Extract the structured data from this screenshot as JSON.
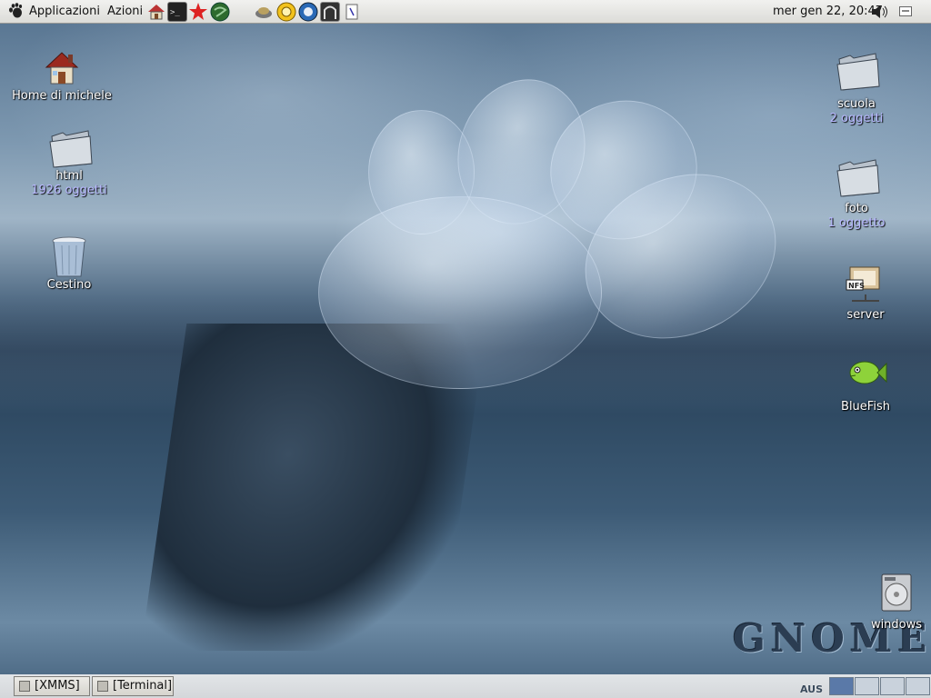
{
  "top_panel": {
    "menus": [
      "Applicazioni",
      "Azioni"
    ],
    "launchers": [
      "home-launcher",
      "terminal-launcher",
      "star-launcher",
      "web-launcher",
      "gimp-launcher",
      "sun-launcher",
      "browser-launcher",
      "ethereal-launcher",
      "note-launcher"
    ],
    "clock": "mer gen 22, 20:47"
  },
  "desktop": {
    "left_icons": [
      {
        "name": "Home di michele",
        "icon": "home-icon"
      },
      {
        "name": "html",
        "sub": "1926 oggetti",
        "icon": "folder-icon"
      },
      {
        "name": "Cestino",
        "icon": "trash-icon"
      }
    ],
    "right_icons": [
      {
        "name": "scuola",
        "sub": "2 oggetti",
        "icon": "folder-icon"
      },
      {
        "name": "foto",
        "sub": "1 oggetto",
        "icon": "folder-icon"
      },
      {
        "name": "server",
        "icon": "nfs-server-icon"
      },
      {
        "name": "BlueFish",
        "icon": "bluefish-icon"
      },
      {
        "name": "windows",
        "icon": "hard-disk-icon"
      }
    ],
    "wallpaper_text": "GNOME"
  },
  "bottom_panel": {
    "tasks": [
      "[XMMS]",
      "[Terminal]"
    ],
    "workspace_label": "AUS",
    "workspaces": 4,
    "active_workspace": 1
  },
  "colors": {
    "panel_bg": "#dcdcd8",
    "desktop_text": "#ffffff",
    "sub_text": "#b8b8ff",
    "active_workspace": "#5a79a8"
  }
}
